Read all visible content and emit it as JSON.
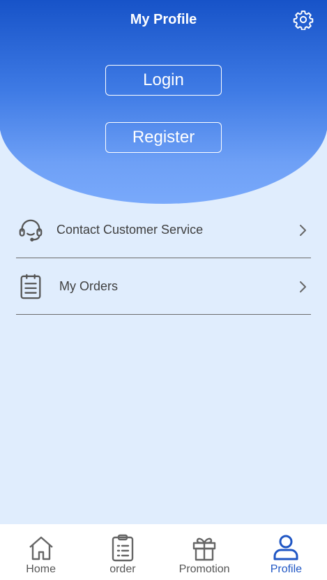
{
  "header": {
    "title": "My Profile",
    "settings_icon": "gear-icon",
    "login_label": "Login",
    "register_label": "Register"
  },
  "menu": {
    "items": [
      {
        "label": "Contact Customer Service",
        "icon": "headset-icon"
      },
      {
        "label": "My Orders",
        "icon": "clipboard-list-icon"
      }
    ]
  },
  "tabbar": {
    "tabs": [
      {
        "label": "Home",
        "icon": "home-icon",
        "active": false
      },
      {
        "label": "order",
        "icon": "clipboard-icon",
        "active": false
      },
      {
        "label": "Promotion",
        "icon": "gift-icon",
        "active": false
      },
      {
        "label": "Profile",
        "icon": "user-icon",
        "active": true
      }
    ]
  },
  "colors": {
    "header_top": "#1753c8",
    "header_bottom": "#79a9fb",
    "page_bg": "#e0edfd",
    "active_tab": "#1f56c4",
    "inactive_tab": "#555555"
  }
}
